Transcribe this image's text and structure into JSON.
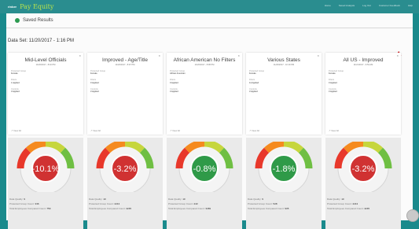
{
  "nav": {
    "logo": "rinker",
    "brand": "Pay Equity",
    "links": [
      "Home",
      "Saved Analysis",
      "Log Out",
      "Customer Feedback",
      "Help"
    ]
  },
  "subheader": {
    "title": "Saved Results"
  },
  "dataset": {
    "label": "Data Set: 11/20/2017 - 1:16 PM"
  },
  "cards": [
    {
      "title": "Mid-Level Officials",
      "date": "11/20/2017 - 8:10 PM",
      "groupLabel": "Protected Group",
      "group": "Female",
      "filtersLabel": "Filters",
      "filters": "1 Applied",
      "controlsLabel": "Controls",
      "controls": "3 Applied",
      "viewAll": "View All",
      "value": "-10.1%",
      "valueNumber": -10.1,
      "color": "#d03232",
      "statLabels": [
        "Data Quality:",
        "Protected Group Count:",
        "Total Employees Compared Count:"
      ],
      "stats": [
        "9",
        "336",
        "759"
      ]
    },
    {
      "title": "Improved - Age/Title",
      "date": "11/20/2017 - 8:07 PM",
      "groupLabel": "Protected Group",
      "group": "Female",
      "filtersLabel": "Filters",
      "filters": "0 Applied",
      "controlsLabel": "Controls",
      "controls": "3 Applied",
      "viewAll": "View All",
      "value": "-3.2%",
      "valueNumber": -3.2,
      "color": "#d03232",
      "statLabels": [
        "Data Quality:",
        "Protected Group Count:",
        "Total Employees Compared Count:"
      ],
      "stats": [
        "10",
        "2213",
        "4245"
      ]
    },
    {
      "title": "African American No Filters",
      "date": "11/20/2017 - 8:08 PM",
      "groupLabel": "Protected Group",
      "group": "African American",
      "filtersLabel": "Filters",
      "filters": "0 Applied",
      "controlsLabel": "Controls",
      "controls": "3 Applied",
      "viewAll": "View All",
      "value": "-0.8%",
      "valueNumber": -0.8,
      "color": "#2f9a48",
      "statLabels": [
        "Data Quality:",
        "Protected Group Count:",
        "Total Employees Compared Count:"
      ],
      "stats": [
        "10",
        "243",
        "3469"
      ]
    },
    {
      "title": "Various States",
      "date": "11/20/2017 - 10:19 PM",
      "groupLabel": "Protected Group",
      "group": "Female",
      "filtersLabel": "Filters",
      "filters": "14 Applied",
      "controlsLabel": "Controls",
      "controls": "3 Applied",
      "viewAll": "View All",
      "value": "-1.8%",
      "valueNumber": -1.8,
      "color": "#2f9a48",
      "statLabels": [
        "Data Quality:",
        "Protected Group Count:",
        "Total Employees Compared Count:"
      ],
      "stats": [
        "9",
        "528",
        "935"
      ]
    },
    {
      "title": "All US - Improved",
      "date": "11/21/2017 - 9:54 AM",
      "groupLabel": "Protected Group",
      "group": "Female",
      "filtersLabel": "Filters",
      "filters": "0 Applied",
      "controlsLabel": "Controls",
      "controls": "3 Applied",
      "viewAll": "View All",
      "value": "-3.2%",
      "valueNumber": -3.2,
      "color": "#d03232",
      "statLabels": [
        "Data Quality:",
        "Protected Group Count:",
        "Total Employees Compared Count:"
      ],
      "stats": [
        "10",
        "2213",
        "4245"
      ]
    }
  ]
}
